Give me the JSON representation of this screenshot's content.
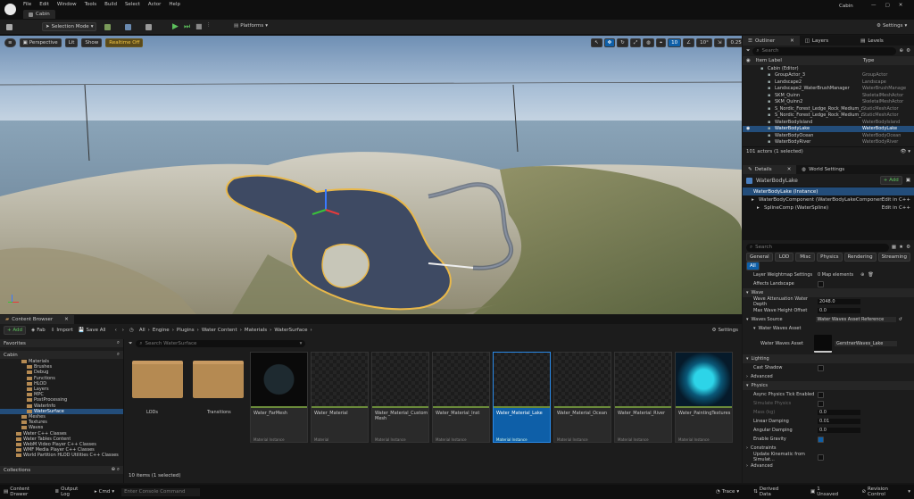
{
  "titlebar": {
    "menus": [
      "File",
      "Edit",
      "Window",
      "Tools",
      "Build",
      "Select",
      "Actor",
      "Help"
    ],
    "project": "Cabin",
    "tab": "Cabin"
  },
  "toolbar": {
    "mode": "Selection Mode",
    "platforms": "Platforms",
    "settings": "Settings"
  },
  "viewport": {
    "perspective": "Perspective",
    "lit": "Lit",
    "show": "Show",
    "realtime": "Realtime Off",
    "grid_snap": "10",
    "angle_snap": "10°",
    "scale_snap": "0.25",
    "cam_speed": "4"
  },
  "outliner": {
    "tabs": [
      "Outliner",
      "Layers",
      "Levels"
    ],
    "search": "Search",
    "col_label": "Item Label",
    "col_type": "Type",
    "rows": [
      {
        "label": "Cabin (Editor)",
        "type": ""
      },
      {
        "label": "GroupActor_3",
        "type": "GroupActor"
      },
      {
        "label": "Landscape2",
        "type": "Landscape"
      },
      {
        "label": "Landscape2_WaterBrushManager",
        "type": "WaterBrushManage"
      },
      {
        "label": "SKM_Quinn",
        "type": "SkeletalMeshActor"
      },
      {
        "label": "SKM_Quinn2",
        "type": "SkeletalMeshActor"
      },
      {
        "label": "S_Nordic_Forest_Ledge_Rock_Medium_xsib",
        "type": "StaticMeshActor"
      },
      {
        "label": "S_Nordic_Forest_Ledge_Rock_Medium_xsib",
        "type": "StaticMeshActor"
      },
      {
        "label": "WaterBodyIsland",
        "type": "WaterBodyIsland"
      },
      {
        "label": "WaterBodyLake",
        "type": "WaterBodyLake"
      },
      {
        "label": "WaterBodyOcean",
        "type": "WaterBodyOcean"
      },
      {
        "label": "WaterBodyRiver",
        "type": "WaterBodyRiver"
      }
    ],
    "status": "101 actors (1 selected)"
  },
  "details": {
    "tabs": [
      "Details",
      "World Settings"
    ],
    "actor": "WaterBodyLake",
    "add": "+ Add",
    "components": [
      {
        "label": "WaterBodyLake (Instance)",
        "edit": ""
      },
      {
        "label": "WaterBodyComponent (WaterBodyLakeComponent)",
        "edit": "Edit in C++"
      },
      {
        "label": "SplineComp (WaterSpline)",
        "edit": "Edit in C++"
      }
    ],
    "search": "Search",
    "cats": [
      "General",
      "LOD",
      "Misc",
      "Physics",
      "Rendering",
      "Streaming"
    ],
    "all": "All",
    "p1": {
      "label": "Layer Weightmap Settings",
      "value": "0 Map elements"
    },
    "p2": {
      "label": "Affects Landscape"
    },
    "sec_wave": "Wave",
    "p3": {
      "label": "Wave Attenuation Water Depth",
      "value": "2048.0"
    },
    "p4": {
      "label": "Max Wave Height Offset",
      "value": "0.0"
    },
    "p5": {
      "label": "Waves Source",
      "value": "Water Waves Asset Reference"
    },
    "waves_asset_sec": "Water Waves Asset",
    "waves_asset_label": "Water Waves Asset",
    "waves_asset_value": "GerstnerWaves_Lake",
    "sec_lighting": "Lighting",
    "cast_shadow": "Cast Shadow",
    "advanced1": "Advanced",
    "sec_physics": "Physics",
    "ph": [
      {
        "label": "Async Physics Tick Enabled",
        "value": ""
      },
      {
        "label": "Simulate Physics",
        "value": ""
      },
      {
        "label": "Mass (kg)",
        "value": "0.0"
      },
      {
        "label": "Linear Damping",
        "value": "0.01"
      },
      {
        "label": "Angular Damping",
        "value": "0.0"
      },
      {
        "label": "Enable Gravity",
        "value": ""
      }
    ],
    "constraints": "Constraints",
    "update_kin": "Update Kinematic from Simulat...",
    "advanced2": "Advanced"
  },
  "content_browser": {
    "tab": "Content Browser",
    "add": "+ Add",
    "fab": "Fab",
    "import": "Import",
    "save_all": "Save All",
    "settings": "Settings",
    "path": [
      "All",
      "Engine",
      "Plugins",
      "Water Content",
      "Materials",
      "WaterSurface"
    ],
    "favorites": "Favorites",
    "root": "Cabin",
    "tree": [
      "Materials",
      "Brushes",
      "Debug",
      "Functions",
      "HLOD",
      "Layers",
      "MPC",
      "PostProcessing",
      "WaterInfo",
      "WaterSurface",
      "Meshes",
      "Textures",
      "Waves",
      "Water C++ Classes",
      "Water Tables Content",
      "WebM Video Player C++ Classes",
      "WMF Media Player C++ Classes",
      "World Partition HLOD Utilities C++ Classes"
    ],
    "collections": "Collections",
    "search": "Search WaterSurface",
    "assets": [
      {
        "name": "LODs",
        "type": ""
      },
      {
        "name": "Transitions",
        "type": ""
      },
      {
        "name": "Water_FarMesh",
        "type": "Material Instance"
      },
      {
        "name": "Water_Material",
        "type": "Material"
      },
      {
        "name": "Water_Material_Custom Mesh",
        "type": "Material Instance"
      },
      {
        "name": "Water_Material_Inst",
        "type": "Material Instance"
      },
      {
        "name": "Water_Material_Lake",
        "type": "Material Instance"
      },
      {
        "name": "Water_Material_Ocean",
        "type": "Material Instance"
      },
      {
        "name": "Water_Material_River",
        "type": "Material Instance"
      },
      {
        "name": "Water_PaintingTextures",
        "type": "Material Instance"
      }
    ],
    "count": "10 items (1 selected)"
  },
  "statusbar": {
    "drawer": "Content Drawer",
    "output": "Output Log",
    "cmd": "Cmd",
    "console": "Enter Console Command",
    "trace": "Trace",
    "derived": "Derived Data",
    "unsaved": "1 Unsaved",
    "rc": "Revision Control"
  },
  "colors": {
    "accent": "#0e5fa8",
    "folder": "#b58a52",
    "selected_row": "#234d7a"
  }
}
